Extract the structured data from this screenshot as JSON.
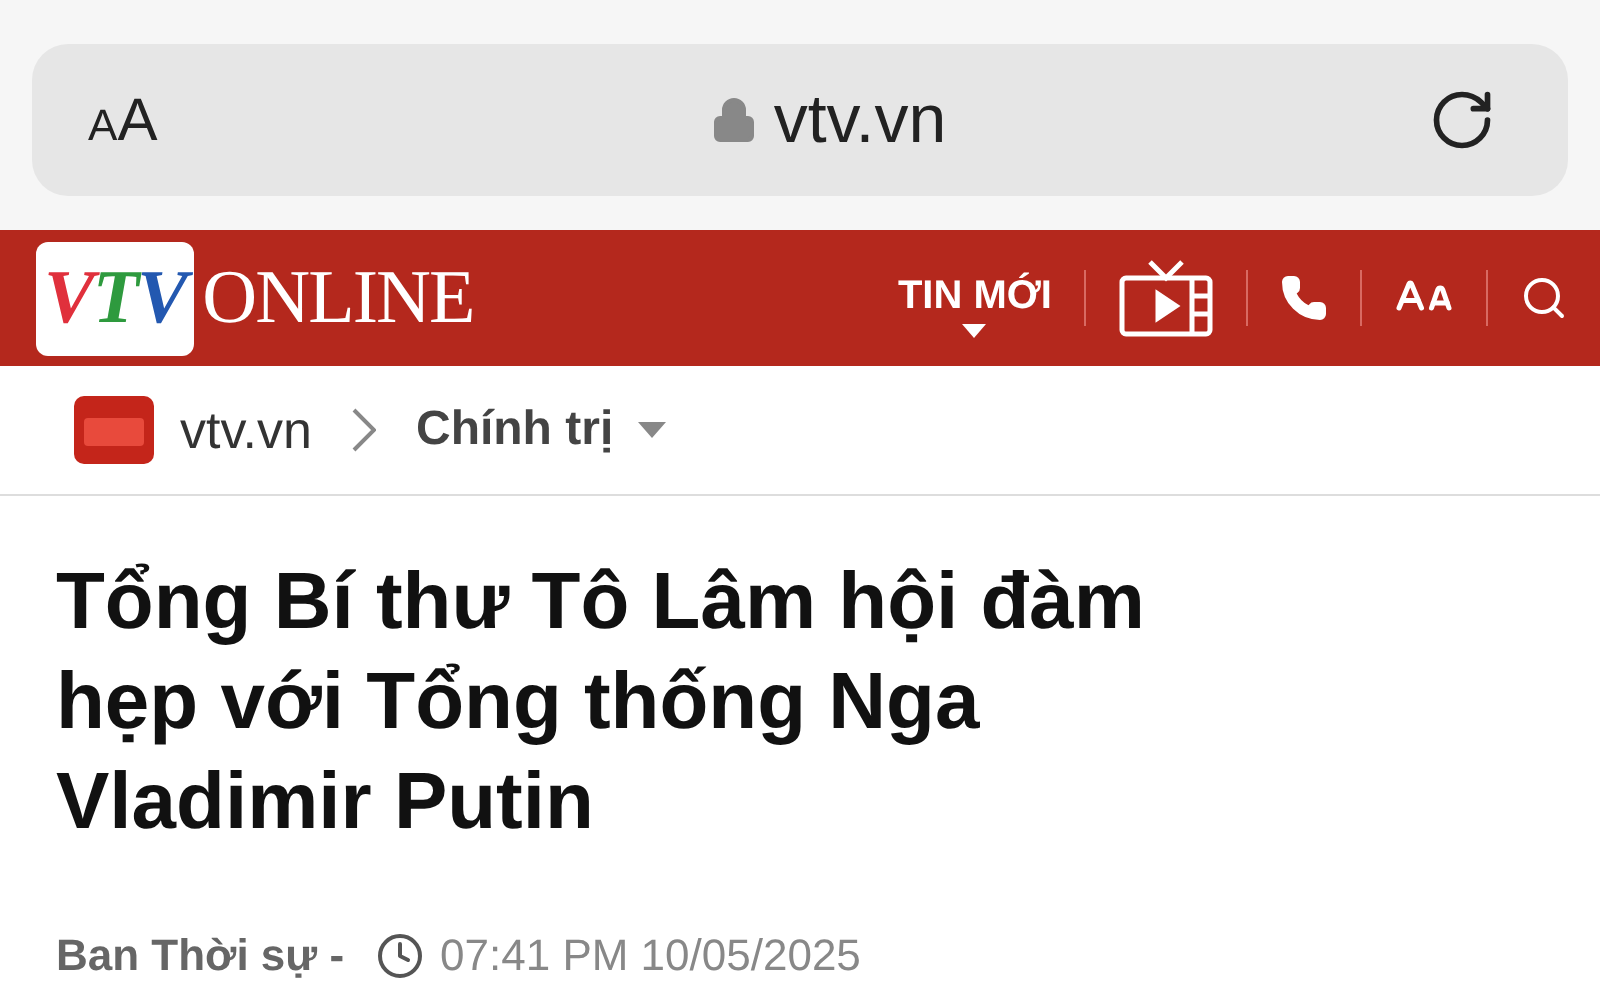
{
  "address_bar": {
    "text_size": {
      "small": "A",
      "large": "A"
    },
    "url": "vtv.vn",
    "secure": true
  },
  "site_header": {
    "logo": {
      "letters": [
        {
          "char": "V",
          "color": "#e0303c"
        },
        {
          "char": "T",
          "color": "#2e9a3e"
        },
        {
          "char": "V",
          "color": "#2358b0"
        }
      ],
      "suffix": "ONLINE"
    },
    "latest_menu": "TIN MỚI"
  },
  "breadcrumb": [
    {
      "label": "vtv.vn",
      "kind": "home"
    },
    {
      "label": "Chính trị",
      "kind": "section"
    }
  ],
  "article": {
    "headline": "Tổng Bí thư Tô Lâm hội đàm hẹp với Tổng thống Nga Vladimir Putin",
    "author": "Ban Thời sự -",
    "time": "07:41 PM 10/05/2025"
  }
}
